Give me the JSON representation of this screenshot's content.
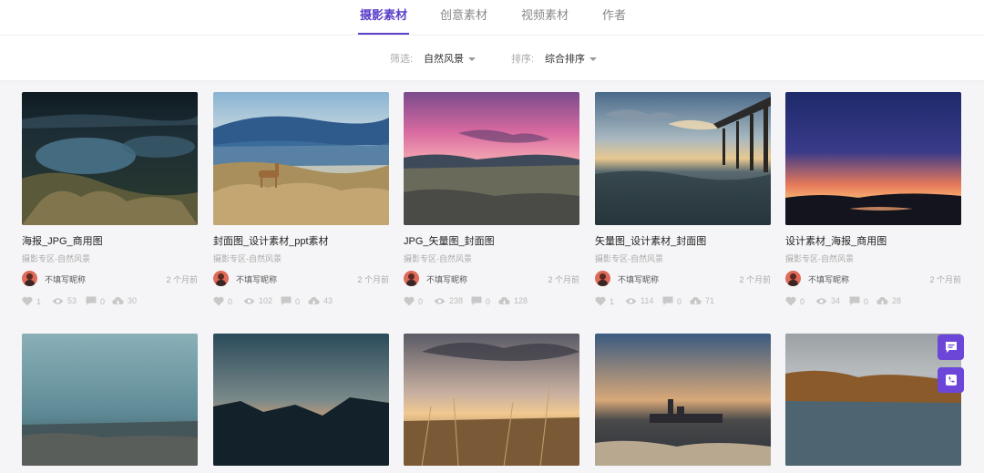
{
  "nav": {
    "tabs": [
      "摄影素材",
      "创意素材",
      "视频素材",
      "作者"
    ]
  },
  "filters": {
    "filter_label": "筛选:",
    "filter_value": "自然风景",
    "sort_label": "排序:",
    "sort_value": "综合排序"
  },
  "cards": [
    {
      "title": "海报_JPG_商用图",
      "category": "摄影专区-自然风景",
      "author": "不填写昵称",
      "time": "2 个月前",
      "likes": "1",
      "views": "53",
      "comments": "0",
      "downloads": "30"
    },
    {
      "title": "封面图_设计素材_ppt素材",
      "category": "摄影专区-自然风景",
      "author": "不填写昵称",
      "time": "2 个月前",
      "likes": "0",
      "views": "102",
      "comments": "0",
      "downloads": "43"
    },
    {
      "title": "JPG_矢量图_封面图",
      "category": "摄影专区-自然风景",
      "author": "不填写昵称",
      "time": "2 个月前",
      "likes": "0",
      "views": "238",
      "comments": "0",
      "downloads": "128"
    },
    {
      "title": "矢量图_设计素材_封面图",
      "category": "摄影专区-自然风景",
      "author": "不填写昵称",
      "time": "2 个月前",
      "likes": "1",
      "views": "114",
      "comments": "0",
      "downloads": "71"
    },
    {
      "title": "设计素材_海报_商用图",
      "category": "摄影专区-自然风景",
      "author": "不填写昵称",
      "time": "2 个月前",
      "likes": "0",
      "views": "34",
      "comments": "0",
      "downloads": "28"
    }
  ],
  "float_buttons": [
    {
      "icon": "message-icon",
      "color": "#6c46d9"
    },
    {
      "icon": "phone-icon",
      "color": "#6c46d9"
    }
  ],
  "colors": {
    "accent": "#5b3fc8",
    "background": "#f5f5f7"
  }
}
